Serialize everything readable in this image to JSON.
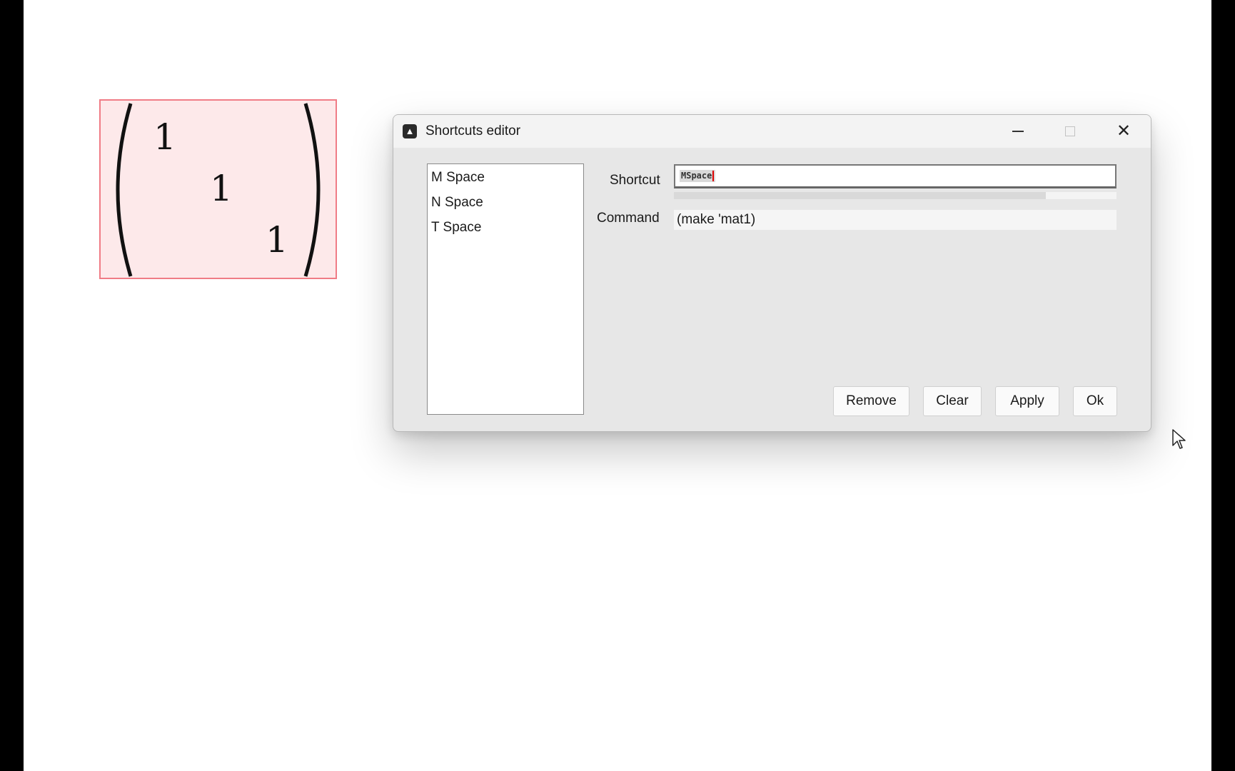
{
  "matrix": {
    "entries": [
      "1",
      "1",
      "1"
    ]
  },
  "dialog": {
    "title": "Shortcuts editor",
    "shortcuts": [
      {
        "label": "M  Space"
      },
      {
        "label": "N  Space"
      },
      {
        "label": "T  Space"
      }
    ],
    "shortcut_label": "Shortcut",
    "shortcut_value": "MSpace",
    "shortcut_progress_fraction": 0.84,
    "command_label": "Command",
    "command_value": "(make 'mat1)",
    "buttons": {
      "remove": "Remove",
      "clear": "Clear",
      "apply": "Apply",
      "ok": "Ok"
    }
  },
  "icons": {
    "app": "app-icon",
    "minimize": "minimize-icon",
    "maximize": "maximize-icon",
    "close": "close-icon",
    "cursor": "mouse-pointer-icon"
  }
}
